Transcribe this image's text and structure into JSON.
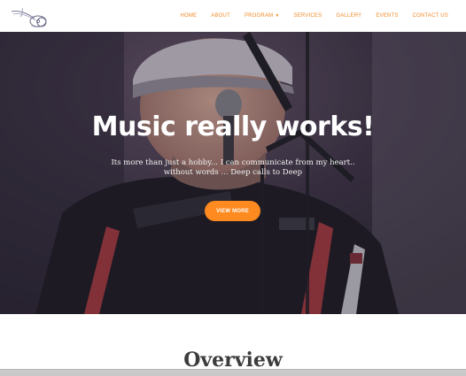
{
  "colors": {
    "accent": "#ff8a1f",
    "nav_text": "#f08a28",
    "hero_title": "#ffffff",
    "hero_text": "#f2f2f2",
    "cta_text": "#ffffff",
    "overview_text": "#3c3c3c"
  },
  "header": {
    "logo_icon": "guitar-logo-icon",
    "nav": [
      {
        "label": "HOME"
      },
      {
        "label": "ABOUT"
      },
      {
        "label": "PROGRAM",
        "has_dropdown": true
      },
      {
        "label": "SERVICES"
      },
      {
        "label": "GALLERY"
      },
      {
        "label": "EVENTS"
      },
      {
        "label": "CONTACT US"
      }
    ]
  },
  "hero": {
    "title": "Music really works!",
    "subtitle_line1": "Its more than just a hobby... I can communicate from my heart..",
    "subtitle_line2": "without words ... Deep calls to Deep",
    "cta_label": "VIEW MORE"
  },
  "overview": {
    "title": "Overview"
  }
}
